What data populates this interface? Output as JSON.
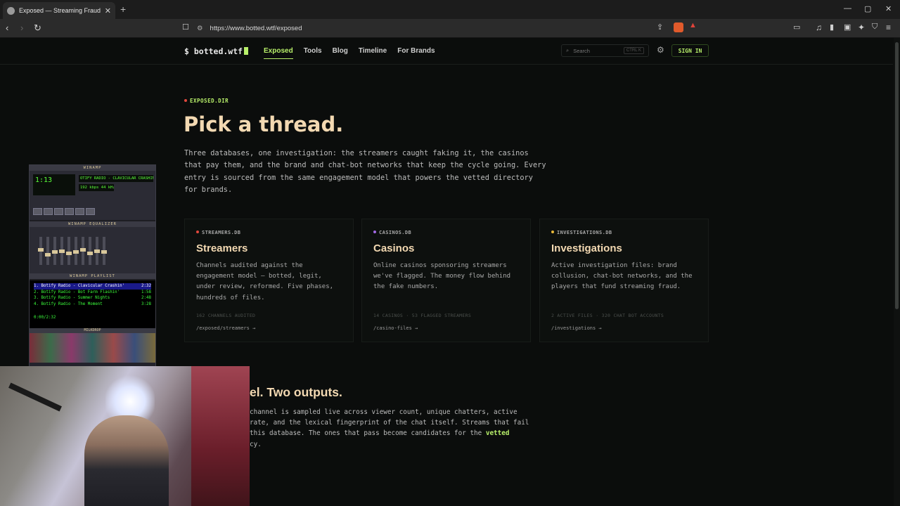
{
  "browser": {
    "tab_title": "Exposed — Streaming Fraud Dat",
    "tab_close": "✕",
    "new_tab": "+",
    "url": "https://www.botted.wtf/exposed",
    "icons": [
      "back-icon",
      "forward-icon",
      "reload-icon",
      "bookmark-icon",
      "site-info-icon",
      "share-icon",
      "brave-shields-icon",
      "brave-rewards-icon",
      "reader-icon",
      "media-icon",
      "sidebar-icon",
      "wallet-icon",
      "leo-icon",
      "vpn-icon",
      "menu-icon"
    ]
  },
  "nav": {
    "logo": "$ botted.wtf",
    "links": [
      "Exposed",
      "Tools",
      "Blog",
      "Timeline",
      "For Brands"
    ],
    "search_placeholder": "Search",
    "search_shortcut": "CTRL K",
    "signin": "SIGN IN",
    "accent": "#b8f06a"
  },
  "hero": {
    "eyebrow": "EXPOSED.DIR",
    "title": "Pick a thread.",
    "intro": "Three databases, one investigation: the streamers caught faking it, the casinos that pay them, and the brand and chat-bot networks that keep the cycle going. Every entry is sourced from the same engagement model that powers the vetted directory for brands."
  },
  "cards": [
    {
      "db": "STREAMERS.DB",
      "dot": "#e2483d",
      "title": "Streamers",
      "desc": "Channels audited against the engagement model — botted, legit, under review, reformed. Five phases, hundreds of files.",
      "meta": "162 CHANNELS AUDITED",
      "link": "/exposed/streamers →"
    },
    {
      "db": "CASINOS.DB",
      "dot": "#a36ae6",
      "title": "Casinos",
      "desc": "Online casinos sponsoring streamers we've flagged. The money flow behind the fake numbers.",
      "meta": "14 CASINOS · 53 FLAGGED STREAMERS",
      "link": "/casino-files →"
    },
    {
      "db": "INVESTIGATIONS.DB",
      "dot": "#e8b93a",
      "title": "Investigations",
      "desc": "Active investigation files: brand collusion, chat-bot networks, and the players that fund streaming fraud.",
      "meta": "2 ACTIVE FILES · 320 CHAT BOT ACCOUNTS",
      "link": "/investigations →"
    }
  ],
  "section2": {
    "title": "el. Two outputs.",
    "para_lines": [
      "channel is sampled live across viewer count, unique chatters, active",
      "rate, and the lexical fingerprint of the chat itself. Streams that fail",
      "this database. The ones that pass become candidates for the "
    ],
    "para_hl": "vetted",
    "para_last": "cy."
  },
  "winamp": {
    "title": "WINAMP",
    "lcd_time": "1:13",
    "ticker": "OTIFY RADIO - CLAVICULAR CRASHIN",
    "kbps": "192 kbps 44 kHz",
    "eq_title": "WINAMP EQUALIZER",
    "eq_levels": [
      0.55,
      0.35,
      0.45,
      0.5,
      0.4,
      0.45,
      0.55,
      0.4,
      0.5,
      0.45
    ],
    "playlist_title": "WINAMP PLAYLIST",
    "playlist": [
      {
        "n": "1. Botify Radio - Clavicular Crashin'",
        "t": "2:32"
      },
      {
        "n": "2. Botify Radio - Bot Farm Flashin'",
        "t": "1:58"
      },
      {
        "n": "3. Botify Radio - Summer Nights",
        "t": "2:48"
      },
      {
        "n": "4. Botify Radio - The Moment",
        "t": "3:28"
      }
    ],
    "playlist_time": "0:00/2:32",
    "milkdrop_title": "MILKDROP"
  }
}
